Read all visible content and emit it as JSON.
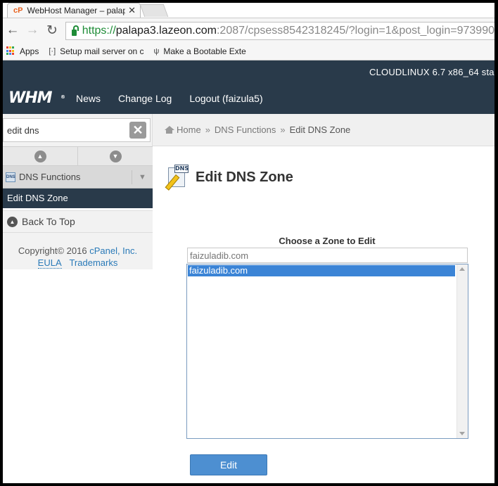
{
  "browser": {
    "tab_title": "WebHost Manager – palap",
    "tab_favicon": "cP",
    "tab_close": "✕",
    "url_scheme": "https://",
    "url_host": "palapa3.lazeon.com",
    "url_path": ":2087/cpsess8542318245/?login=1&post_login=973990",
    "bookmarks": {
      "apps": "Apps",
      "item1": "Setup mail server on c",
      "item2": "Make a Bootable Exte"
    },
    "apps_colors": [
      "#ea4335",
      "#fbbc05",
      "#34a853",
      "#4285f4",
      "#ea4335",
      "#fbbc05",
      "#34a853",
      "#4285f4",
      "#ea4335"
    ]
  },
  "whm": {
    "server_info": "CLOUDLINUX 6.7 x86_64 sta",
    "logo": "WHM",
    "nav": {
      "news": "News",
      "changelog": "Change Log",
      "logout": "Logout (faizula5)"
    },
    "header_color": "#293a4a"
  },
  "sidebar": {
    "search_value": "edit dns",
    "category": "DNS Functions",
    "category_icon_text": "DNS",
    "active_item": "Edit DNS Zone",
    "back_to_top": "Back To Top",
    "copyright_text": "Copyright© 2016 ",
    "copyright_company": "cPanel, Inc.",
    "eula": "EULA",
    "trademarks": "Trademarks"
  },
  "breadcrumb": {
    "home": "Home",
    "sep": "»",
    "parent": "DNS Functions",
    "current": "Edit DNS Zone"
  },
  "main": {
    "title": "Edit DNS Zone",
    "icon_text": "DNS",
    "zone_label": "Choose a Zone to Edit",
    "zone_filter_placeholder": "faizuladib.com",
    "zones": [
      "faizuladib.com"
    ],
    "edit_button": "Edit",
    "accent_color": "#4d8fd1"
  }
}
